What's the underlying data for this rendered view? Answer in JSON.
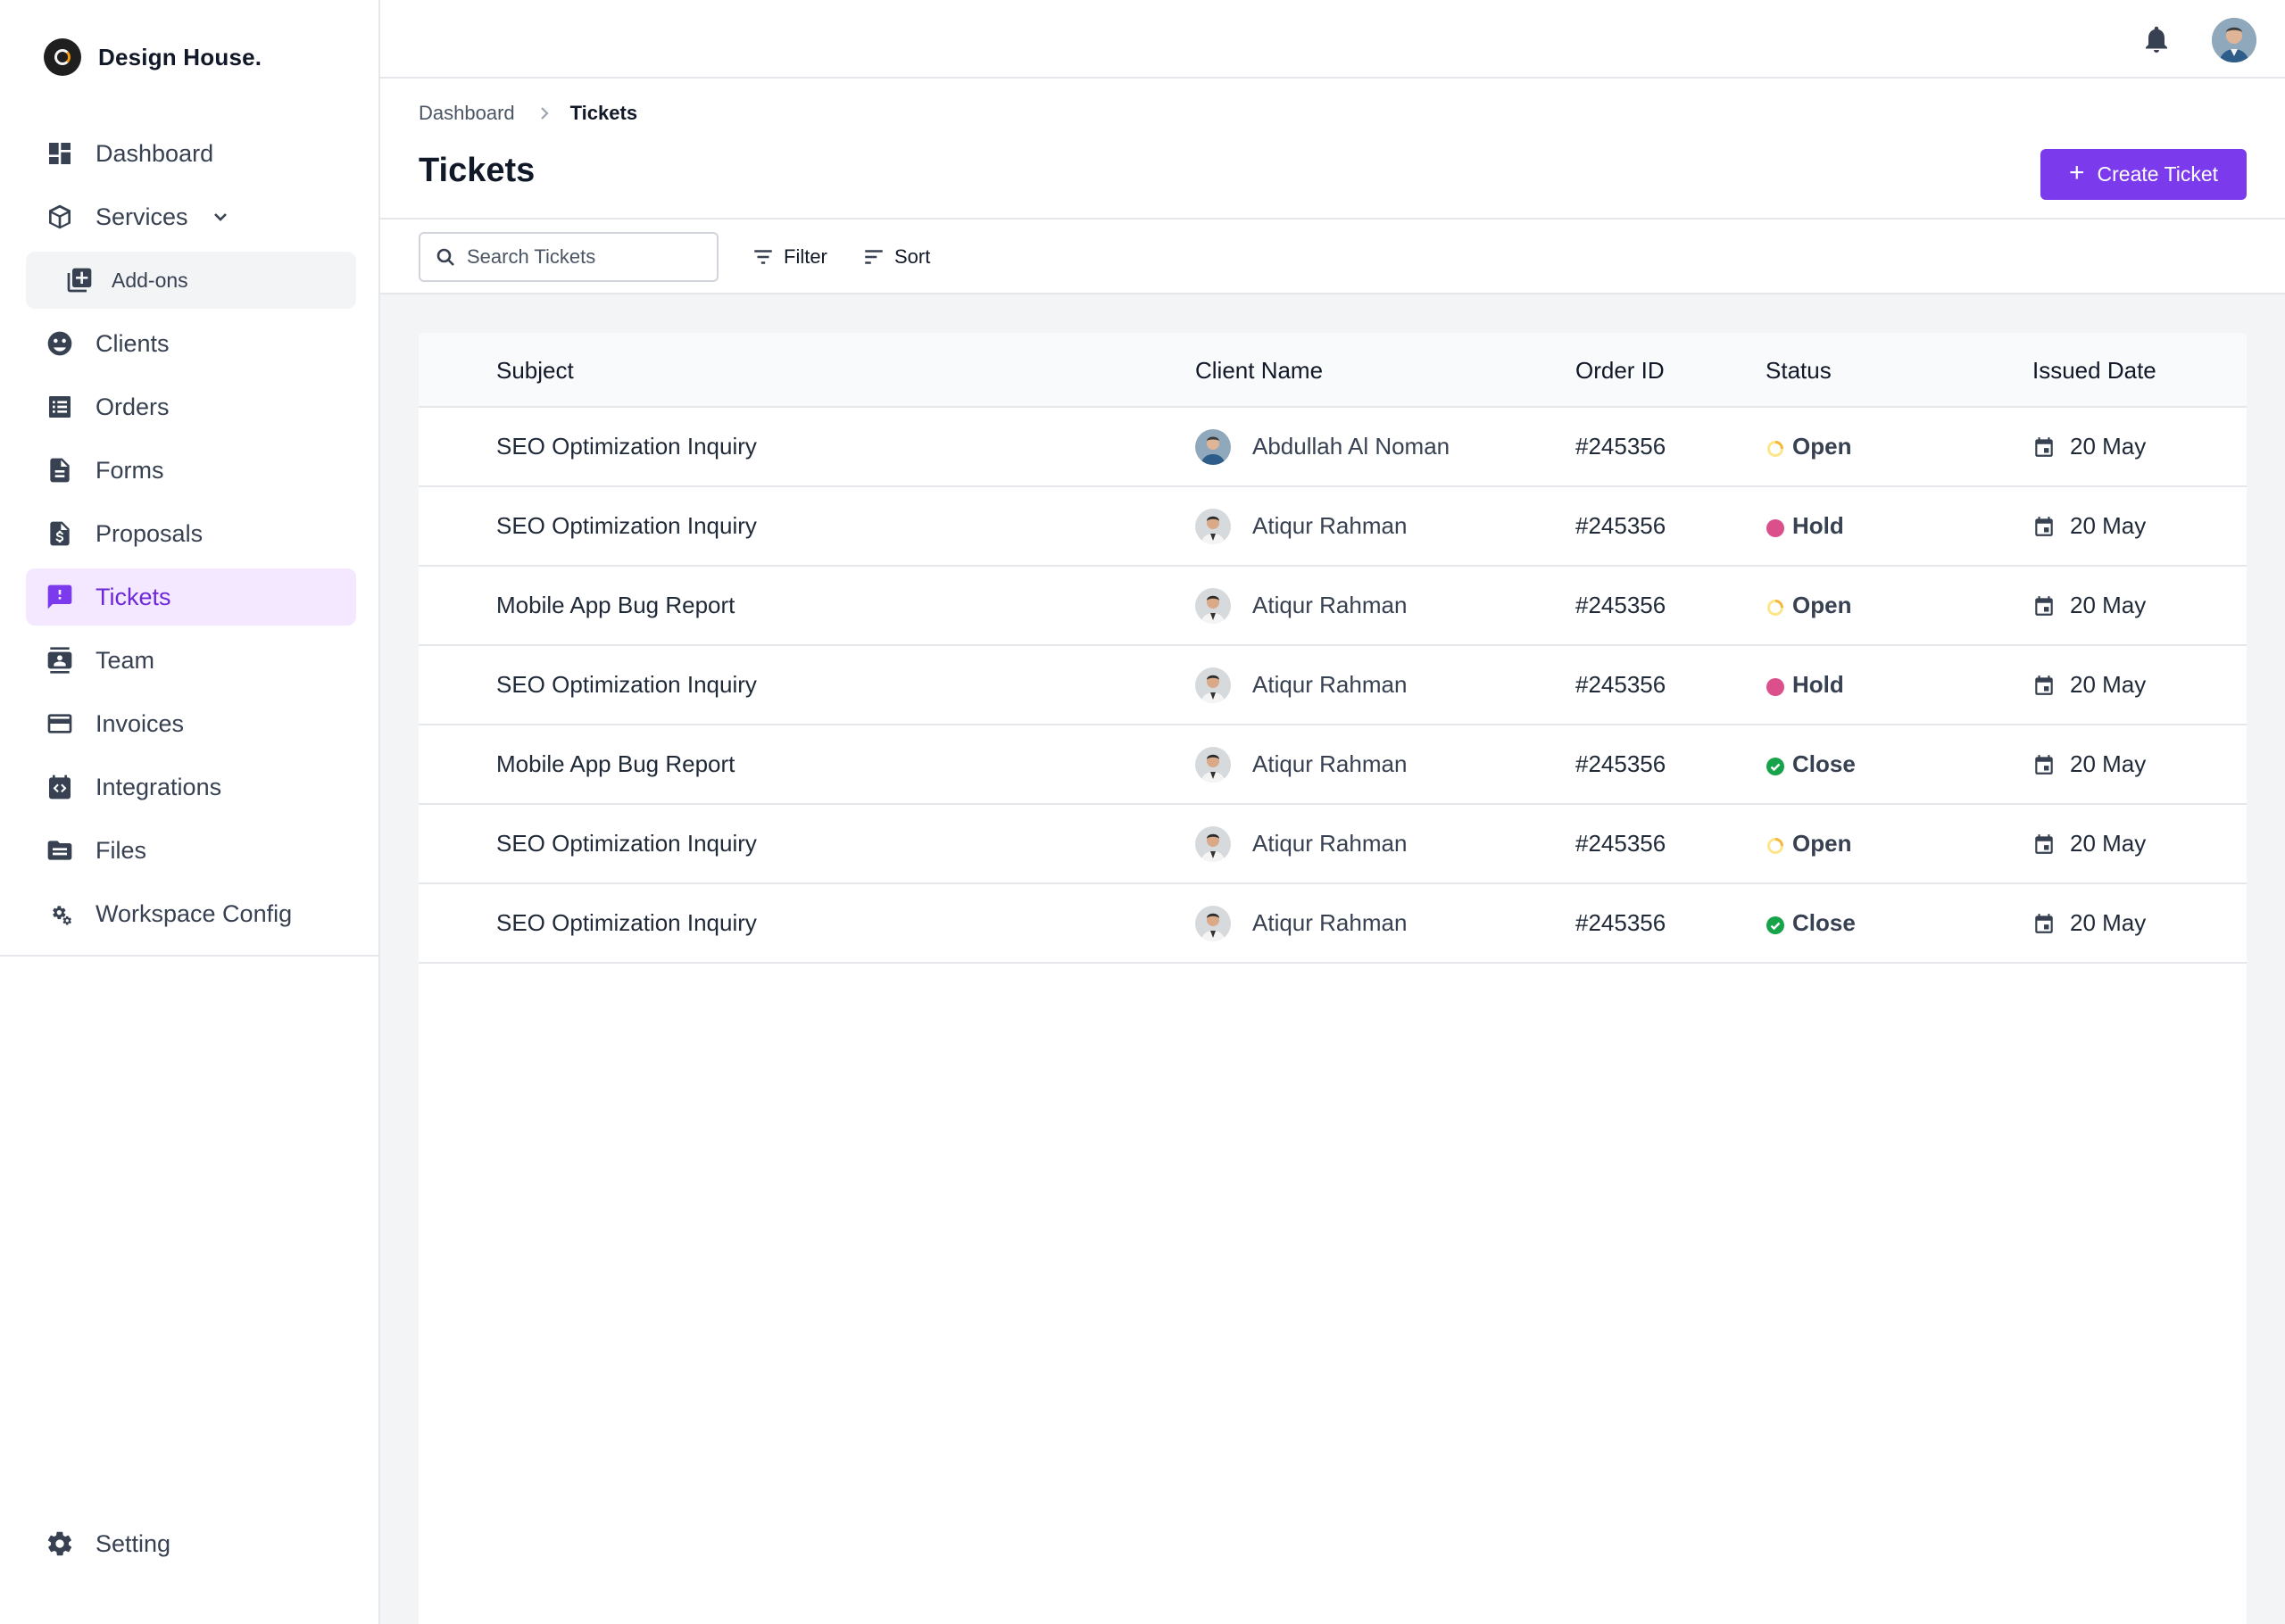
{
  "brand": {
    "name": "Design House."
  },
  "sidebar": {
    "items": [
      {
        "label": "Dashboard",
        "icon": "dashboard-icon"
      },
      {
        "label": "Services",
        "icon": "package-icon",
        "expanded": true
      },
      {
        "label": "Add-ons",
        "icon": "add-box-icon",
        "sub": true
      },
      {
        "label": "Clients",
        "icon": "clients-icon"
      },
      {
        "label": "Orders",
        "icon": "list-icon"
      },
      {
        "label": "Forms",
        "icon": "document-icon"
      },
      {
        "label": "Proposals",
        "icon": "proposal-icon"
      },
      {
        "label": "Tickets",
        "icon": "ticket-icon",
        "active": true
      },
      {
        "label": "Team",
        "icon": "team-icon"
      },
      {
        "label": "Invoices",
        "icon": "card-icon"
      },
      {
        "label": "Integrations",
        "icon": "integration-icon"
      },
      {
        "label": "Files",
        "icon": "folder-icon"
      },
      {
        "label": "Workspace Config",
        "icon": "gear-cog-icon"
      }
    ],
    "bottom": {
      "label": "Setting",
      "icon": "gear-icon"
    }
  },
  "breadcrumb": {
    "parent": "Dashboard",
    "current": "Tickets"
  },
  "page": {
    "title": "Tickets",
    "create_label": "Create Ticket"
  },
  "toolbar": {
    "search_placeholder": "Search Tickets",
    "filter_label": "Filter",
    "sort_label": "Sort"
  },
  "table": {
    "headers": {
      "subject": "Subject",
      "client": "Client Name",
      "order": "Order ID",
      "status": "Status",
      "date": "Issued Date"
    },
    "rows": [
      {
        "subject": "SEO Optimization Inquiry",
        "client": "Abdullah Al Noman",
        "order": "#245356",
        "status": "Open",
        "date": "20 May"
      },
      {
        "subject": "SEO Optimization Inquiry",
        "client": "Atiqur Rahman",
        "order": "#245356",
        "status": "Hold",
        "date": "20 May"
      },
      {
        "subject": "Mobile App Bug Report",
        "client": "Atiqur Rahman",
        "order": "#245356",
        "status": "Open",
        "date": "20 May"
      },
      {
        "subject": "SEO Optimization Inquiry",
        "client": "Atiqur Rahman",
        "order": "#245356",
        "status": "Hold",
        "date": "20 May"
      },
      {
        "subject": "Mobile App Bug Report",
        "client": "Atiqur Rahman",
        "order": "#245356",
        "status": "Close",
        "date": "20 May"
      },
      {
        "subject": "SEO Optimization Inquiry",
        "client": "Atiqur Rahman",
        "order": "#245356",
        "status": "Open",
        "date": "20 May"
      },
      {
        "subject": "SEO Optimization Inquiry",
        "client": "Atiqur Rahman",
        "order": "#245356",
        "status": "Close",
        "date": "20 May"
      }
    ]
  },
  "colors": {
    "accent": "#7c3aed",
    "active_bg": "#f3e8ff",
    "open": "#f5b83d",
    "hold": "#db4f8b",
    "close": "#16a34a"
  }
}
